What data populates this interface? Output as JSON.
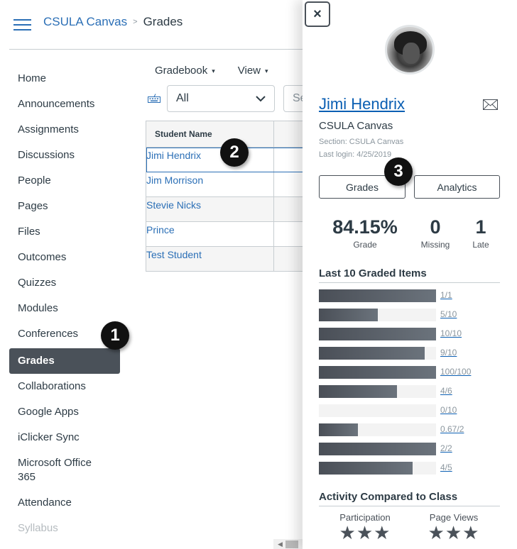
{
  "header": {
    "menu_icon": "hamburger-icon",
    "breadcrumb": {
      "course": "CSULA Canvas",
      "separator": ">",
      "current": "Grades"
    }
  },
  "nav": {
    "items": [
      {
        "label": "Home"
      },
      {
        "label": "Announcements"
      },
      {
        "label": "Assignments"
      },
      {
        "label": "Discussions"
      },
      {
        "label": "People"
      },
      {
        "label": "Pages"
      },
      {
        "label": "Files"
      },
      {
        "label": "Outcomes"
      },
      {
        "label": "Quizzes"
      },
      {
        "label": "Modules"
      },
      {
        "label": "Conferences"
      },
      {
        "label": "Grades",
        "active": true
      },
      {
        "label": "Collaborations"
      },
      {
        "label": "Google Apps"
      },
      {
        "label": "iClicker Sync"
      },
      {
        "label": "Microsoft Office 365"
      },
      {
        "label": "Attendance"
      },
      {
        "label": "Syllabus",
        "disabled": true
      }
    ]
  },
  "gradebook": {
    "menus": {
      "gradebook": "Gradebook",
      "view": "View",
      "caret": "▾"
    },
    "filter": {
      "value": "All",
      "icon": "chevron-down-icon"
    },
    "search": {
      "placeholder": "Se"
    },
    "keyboard_icon": "keyboard-icon",
    "grid": {
      "header": "Student Name",
      "rows": [
        "Jimi Hendrix",
        "Jim Morrison",
        "Stevie Nicks",
        "Prince",
        "Test Student"
      ]
    }
  },
  "tray": {
    "close_label": "×",
    "student": {
      "name": "Jimi Hendrix",
      "course": "CSULA Canvas",
      "section": "Section: CSULA Canvas",
      "last_login": "Last login: 4/25/2019"
    },
    "buttons": {
      "grades": "Grades",
      "analytics": "Analytics"
    },
    "stats": {
      "grade": {
        "value": "84.15%",
        "label": "Grade"
      },
      "missing": {
        "value": "0",
        "label": "Missing"
      },
      "late": {
        "value": "1",
        "label": "Late"
      }
    },
    "graded_items_title": "Last 10 Graded Items",
    "graded_items": [
      {
        "score": "1/1",
        "fraction": 1.0
      },
      {
        "score": "5/10",
        "fraction": 0.5
      },
      {
        "score": "10/10",
        "fraction": 1.0
      },
      {
        "score": "9/10",
        "fraction": 0.9
      },
      {
        "score": "100/100",
        "fraction": 1.0
      },
      {
        "score": "4/6",
        "fraction": 0.667
      },
      {
        "score": "0/10",
        "fraction": 0.0
      },
      {
        "score": "0.67/2",
        "fraction": 0.335
      },
      {
        "score": "2/2",
        "fraction": 1.0
      },
      {
        "score": "4/5",
        "fraction": 0.8
      }
    ],
    "activity": {
      "title": "Activity Compared to Class",
      "participation": {
        "label": "Participation",
        "stars": 3,
        "glyphs": "★★★"
      },
      "page_views": {
        "label": "Page Views",
        "stars": 3,
        "glyphs": "★★★"
      }
    }
  },
  "callouts": [
    "1",
    "2",
    "3"
  ]
}
